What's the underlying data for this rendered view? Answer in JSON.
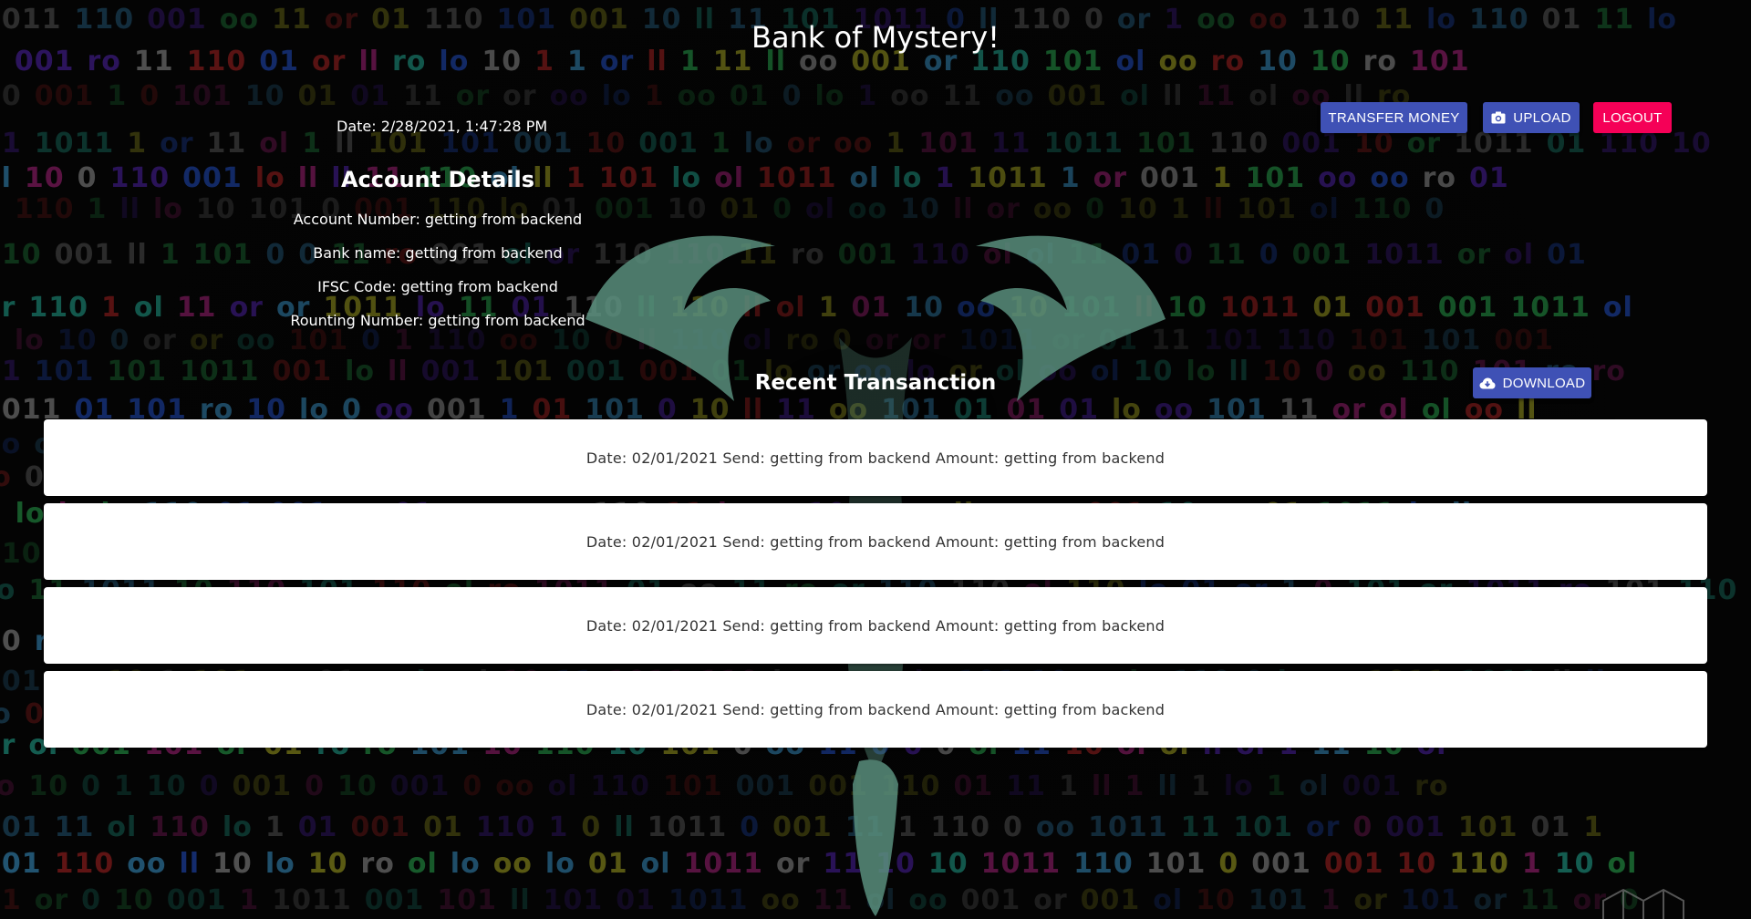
{
  "header": {
    "title": "Bank of Mystery!",
    "date": "Date: 2/28/2021, 1:47:28 PM"
  },
  "toolbar": {
    "transfer_label": "TRANSFER MONEY",
    "upload_label": "UPLOAD",
    "upload_icon": "camera-icon",
    "logout_label": "LOGOUT"
  },
  "account": {
    "title": "Account Details",
    "account_number": "Account Number: getting from backend",
    "bank_name": "Bank name: getting from backend",
    "ifsc": "IFSC Code: getting from backend",
    "routing": "Rounting Number: getting from backend"
  },
  "transactions": {
    "title": "Recent Transanction",
    "download_label": "DOWNLOAD",
    "download_icon": "cloud-download-icon",
    "items": [
      {
        "text": "Date: 02/01/2021 Send: getting from backend Amount: getting from backend"
      },
      {
        "text": "Date: 02/01/2021 Send: getting from backend Amount: getting from backend"
      },
      {
        "text": "Date: 02/01/2021 Send: getting from backend Amount: getting from backend"
      },
      {
        "text": "Date: 02/01/2021 Send: getting from backend Amount: getting from backend"
      }
    ]
  },
  "colors": {
    "primary_button": "#3f51b5",
    "logout_button": "#f50057",
    "card_background": "#ffffff",
    "page_background": "#000000"
  }
}
